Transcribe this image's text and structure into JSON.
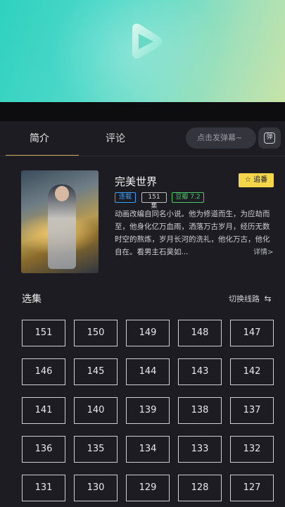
{
  "tabs": {
    "intro": "简介",
    "comment": "评论"
  },
  "danmu": {
    "placeholder": "点击发弹幕~",
    "button_glyph": "弹"
  },
  "show": {
    "title": "完美世界",
    "follow_label": "☆ 追番",
    "tags": {
      "status": "连载",
      "episodes": "151集",
      "rating": "豆瓣 7.2"
    },
    "description": "动画改编自同名小说。他为修道而生，为应劫而至，他身化亿万血雨，洒落万古岁月，经历无数时空的熬炼，岁月长河的洗礼，他化万古，他化自在。看男主石昊如...",
    "detail_label": "详情>"
  },
  "episodes": {
    "header": "选集",
    "switch_label": "切换线路",
    "switch_icon": "⇆",
    "items": [
      "151",
      "150",
      "149",
      "148",
      "147",
      "146",
      "145",
      "144",
      "143",
      "142",
      "141",
      "140",
      "139",
      "138",
      "137",
      "136",
      "135",
      "134",
      "133",
      "132",
      "131",
      "130",
      "129",
      "128",
      "127"
    ]
  },
  "colors": {
    "accent": "#c9a35a",
    "follow": "#f5d54a",
    "status": "#3aa0ff",
    "rating": "#49c96a"
  }
}
